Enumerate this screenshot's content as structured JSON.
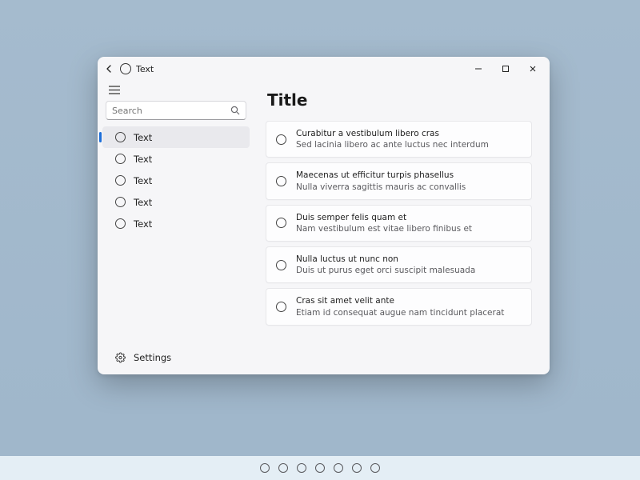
{
  "titlebar": {
    "caption": "Text"
  },
  "search": {
    "placeholder": "Search"
  },
  "sidebar": {
    "items": [
      {
        "label": "Text"
      },
      {
        "label": "Text"
      },
      {
        "label": "Text"
      },
      {
        "label": "Text"
      },
      {
        "label": "Text"
      }
    ],
    "settings_label": "Settings"
  },
  "page": {
    "title": "Title"
  },
  "cards": [
    {
      "primary": "Curabitur a vestibulum libero cras",
      "secondary": "Sed lacinia libero ac ante luctus nec interdum"
    },
    {
      "primary": "Maecenas ut efficitur turpis phasellus",
      "secondary": "Nulla viverra sagittis mauris ac convallis"
    },
    {
      "primary": "Duis semper felis quam et",
      "secondary": "Nam vestibulum est vitae libero finibus et"
    },
    {
      "primary": "Nulla luctus ut nunc non",
      "secondary": "Duis ut purus eget orci suscipit malesuada"
    },
    {
      "primary": "Cras sit amet velit ante",
      "secondary": "Etiam id consequat augue nam tincidunt placerat"
    }
  ],
  "pager": {
    "count": 7
  }
}
